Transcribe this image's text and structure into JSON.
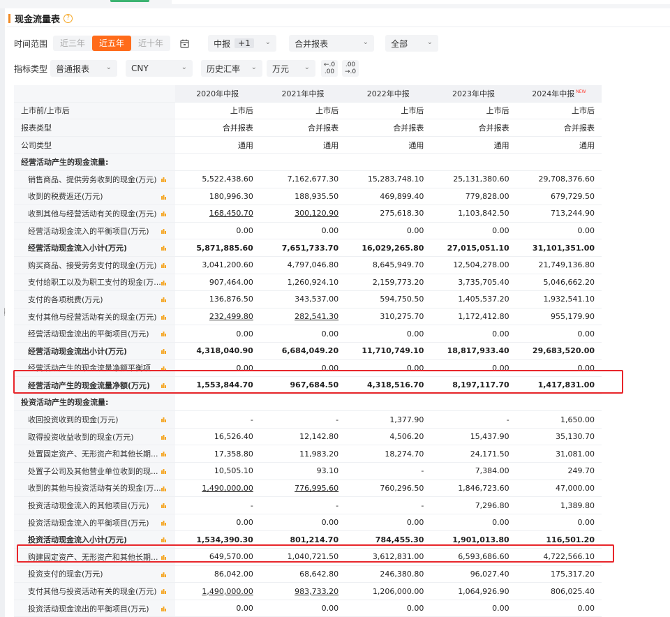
{
  "section": {
    "title": "现金流量表"
  },
  "filters": {
    "time_label": "时间范围",
    "time_options": [
      "近三年",
      "近五年",
      "近十年"
    ],
    "time_active": "近五年",
    "period": "中报",
    "period_plus": "+1",
    "report_scope": "合并报表",
    "scope_all": "全部",
    "indicator_label": "指标类型",
    "indicator_type": "普通报表",
    "currency": "CNY",
    "fx_rate": "历史汇率",
    "unit": "万元",
    "dec_less": [
      "←.0",
      ".00"
    ],
    "dec_more": [
      ".00",
      "→.0"
    ]
  },
  "table": {
    "columns": [
      "2020年中报",
      "2021年中报",
      "2022年中报",
      "2023年中报",
      "2024年中报"
    ],
    "new_badge": "NEW",
    "rows": [
      {
        "name": "上市前/上市后",
        "cells": [
          "上市后",
          "上市后",
          "上市后",
          "上市后",
          "上市后"
        ]
      },
      {
        "name": "报表类型",
        "cells": [
          "合并报表",
          "合并报表",
          "合并报表",
          "合并报表",
          "合并报表"
        ]
      },
      {
        "name": "公司类型",
        "cells": [
          "通用",
          "通用",
          "通用",
          "通用",
          "通用"
        ]
      },
      {
        "name": "经营活动产生的现金流量:",
        "cells": [
          "",
          "",
          "",
          "",
          ""
        ]
      },
      {
        "name": "销售商品、提供劳务收到的现金(万元)",
        "cells": [
          "5,522,438.60",
          "7,162,677.30",
          "15,283,748.10",
          "25,131,380.60",
          "29,708,376.60"
        ]
      },
      {
        "name": "收到的税费返还(万元)",
        "cells": [
          "180,996.30",
          "188,935.50",
          "469,899.40",
          "779,828.00",
          "679,729.50"
        ]
      },
      {
        "name": "收到其他与经营活动有关的现金(万元)",
        "cells": [
          "168,450.70",
          "300,120.90",
          "275,618.30",
          "1,103,842.50",
          "713,244.90"
        ]
      },
      {
        "name": "经营活动现金流入的平衡项目(万元)",
        "cells": [
          "0.00",
          "0.00",
          "0.00",
          "0.00",
          "0.00"
        ]
      },
      {
        "name": "经营活动现金流入小计(万元)",
        "cells": [
          "5,871,885.60",
          "7,651,733.70",
          "16,029,265.80",
          "27,015,051.10",
          "31,101,351.00"
        ]
      },
      {
        "name": "购买商品、接受劳务支付的现金(万元)",
        "cells": [
          "3,041,200.60",
          "4,797,046.80",
          "8,645,949.70",
          "12,504,278.00",
          "21,749,136.80"
        ]
      },
      {
        "name": "支付给职工以及为职工支付的现金(万...",
        "cells": [
          "907,464.00",
          "1,260,924.10",
          "2,159,773.20",
          "3,735,705.40",
          "5,046,662.20"
        ]
      },
      {
        "name": "支付的各项税费(万元)",
        "cells": [
          "136,876.50",
          "343,537.00",
          "594,750.50",
          "1,405,537.20",
          "1,932,541.10"
        ]
      },
      {
        "name": "支付其他与经营活动有关的现金(万元)",
        "cells": [
          "232,499.80",
          "282,541.30",
          "310,275.70",
          "1,172,412.80",
          "955,179.90"
        ]
      },
      {
        "name": "经营活动现金流出的平衡项目(万元)",
        "cells": [
          "0.00",
          "0.00",
          "0.00",
          "0.00",
          "0.00"
        ]
      },
      {
        "name": "经营活动现金流出小计(万元)",
        "cells": [
          "4,318,040.90",
          "6,684,049.20",
          "11,710,749.10",
          "18,817,933.40",
          "29,683,520.00"
        ]
      },
      {
        "name": "经营活动产生的现金流量净额平衡项",
        "cells": [
          "0.00",
          "0.00",
          "0.00",
          "0.00",
          "0.00"
        ]
      },
      {
        "name": "经营活动产生的现金流量净额(万元)",
        "cells": [
          "1,553,844.70",
          "967,684.50",
          "4,318,516.70",
          "8,197,117.70",
          "1,417,831.00"
        ]
      },
      {
        "name": "投资活动产生的现金流量:",
        "cells": [
          "",
          "",
          "",
          "",
          ""
        ]
      },
      {
        "name": "收回投资收到的现金(万元)",
        "cells": [
          "-",
          "-",
          "1,377.90",
          "-",
          "1,650.00"
        ]
      },
      {
        "name": "取得投资收益收到的现金(万元)",
        "cells": [
          "16,526.40",
          "12,142.80",
          "4,506.20",
          "15,437.90",
          "35,130.70"
        ]
      },
      {
        "name": "处置固定资产、无形资产和其他长期...",
        "cells": [
          "17,358.80",
          "11,983.20",
          "18,274.70",
          "24,171.50",
          "31,081.00"
        ]
      },
      {
        "name": "处置子公司及其他营业单位收到的现...",
        "cells": [
          "10,505.10",
          "93.10",
          "-",
          "7,384.00",
          "249.70"
        ]
      },
      {
        "name": "收到的其他与投资活动有关的现金(万...",
        "cells": [
          "1,490,000.00",
          "776,995.60",
          "760,296.50",
          "1,846,723.60",
          "47,000.00"
        ]
      },
      {
        "name": "投资活动现金流入的其他项目(万元)",
        "cells": [
          "-",
          "-",
          "-",
          "7,296.80",
          "1,389.80"
        ]
      },
      {
        "name": "投资活动现金流入的平衡项目(万元)",
        "cells": [
          "0.00",
          "0.00",
          "0.00",
          "0.00",
          "0.00"
        ]
      },
      {
        "name": "投资活动现金流入小计(万元)",
        "cells": [
          "1,534,390.30",
          "801,214.70",
          "784,455.30",
          "1,901,013.80",
          "116,501.20"
        ]
      },
      {
        "name": "购建固定资产、无形资产和其他长期...",
        "cells": [
          "649,570.00",
          "1,040,721.50",
          "3,612,831.00",
          "6,593,686.60",
          "4,722,566.10"
        ]
      },
      {
        "name": "投资支付的现金(万元)",
        "cells": [
          "86,042.00",
          "68,642.80",
          "246,380.80",
          "96,027.40",
          "175,317.20"
        ]
      },
      {
        "name": "支付其他与投资活动有关的现金(万元)",
        "cells": [
          "1,490,000.00",
          "983,733.20",
          "1,206,000.00",
          "1,064,926.90",
          "806,025.40"
        ]
      },
      {
        "name": "投资活动现金流出的平衡项目(万元)",
        "cells": [
          "0.00",
          "0.00",
          "0.00",
          "0.00",
          "0.00"
        ]
      }
    ]
  },
  "colors": {
    "accent": "#ff6b1a",
    "highlight_box": "#e8262b",
    "chart_icon": "#f5a623"
  }
}
